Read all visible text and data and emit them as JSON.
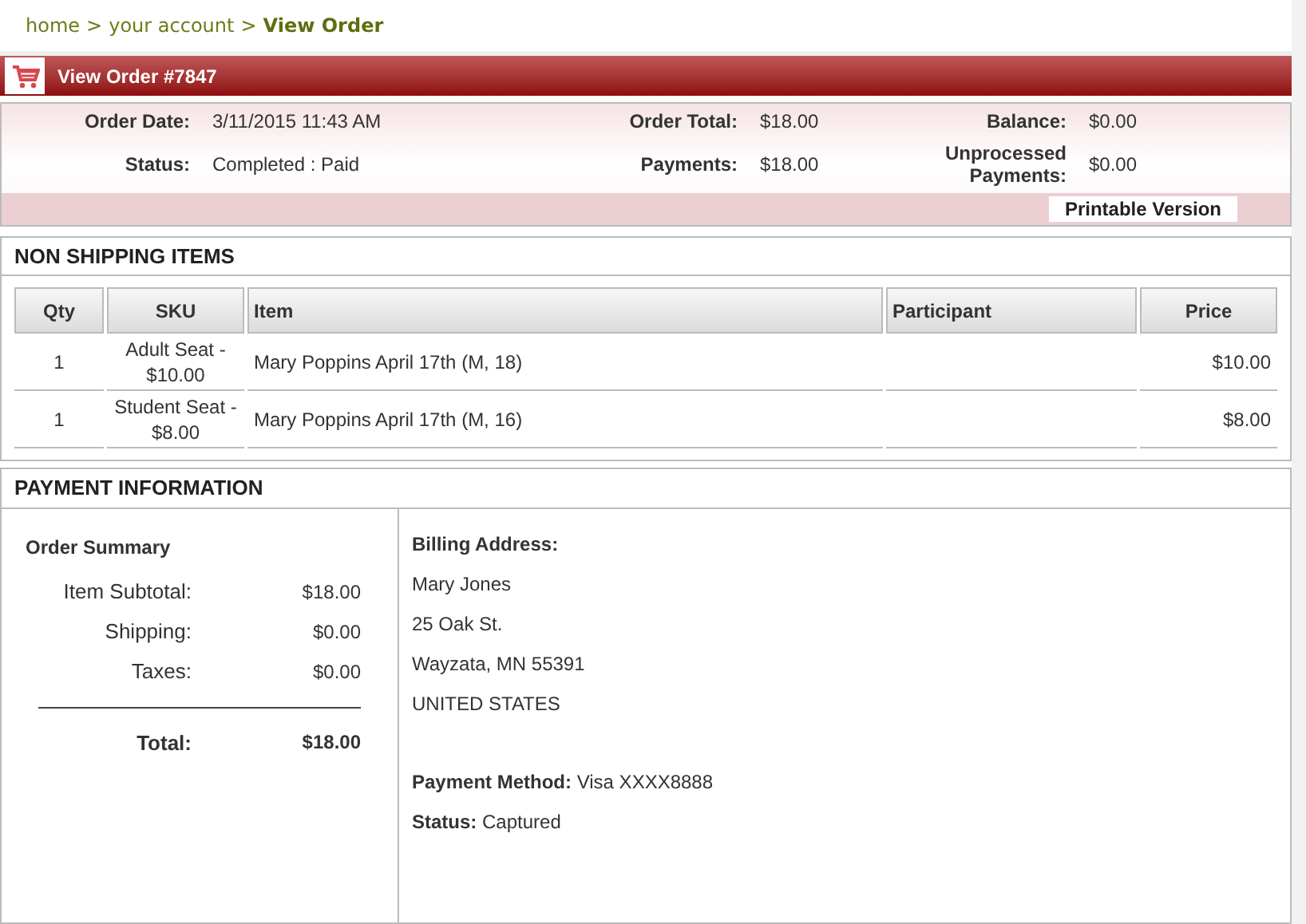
{
  "breadcrumb": {
    "separator": ">",
    "items": [
      {
        "label": "home",
        "current": false
      },
      {
        "label": "your account",
        "current": false
      },
      {
        "label": "View Order",
        "current": true
      }
    ]
  },
  "header": {
    "title": "View Order #7847"
  },
  "summary": {
    "fields": [
      {
        "label": "Order Date:",
        "value": "3/11/2015 11:43 AM"
      },
      {
        "label": "Order Total:",
        "value": "$18.00"
      },
      {
        "label": "Balance:",
        "value": "$0.00"
      },
      {
        "label": "Status:",
        "value": "Completed : Paid"
      },
      {
        "label": "Payments:",
        "value": "$18.00"
      },
      {
        "label": "Unprocessed Payments:",
        "value": "$0.00"
      }
    ],
    "printable_button": "Printable Version"
  },
  "non_shipping": {
    "title": "NON SHIPPING ITEMS",
    "columns": [
      "Qty",
      "SKU",
      "Item",
      "Participant",
      "Price"
    ],
    "rows": [
      [
        "1",
        "Adult Seat - $10.00",
        "Mary Poppins April 17th (M, 18)",
        "",
        "$10.00"
      ],
      [
        "1",
        "Student Seat - $8.00",
        "Mary Poppins April 17th (M, 16)",
        "",
        "$8.00"
      ]
    ]
  },
  "payment": {
    "title": "PAYMENT INFORMATION",
    "order_summary": {
      "title": "Order Summary",
      "lines": [
        {
          "label": "Item Subtotal:",
          "value": "$18.00"
        },
        {
          "label": "Shipping:",
          "value": "$0.00"
        },
        {
          "label": "Taxes:",
          "value": "$0.00"
        }
      ],
      "total": {
        "label": "Total:",
        "value": "$18.00"
      }
    },
    "billing_label": "Billing Address:",
    "address_lines": [
      "Mary Jones",
      "25 Oak St.",
      "Wayzata, MN 55391",
      "UNITED STATES"
    ],
    "details": [
      "**Payment Method:** Visa XXXX8888",
      "**Status:** Captured"
    ]
  }
}
